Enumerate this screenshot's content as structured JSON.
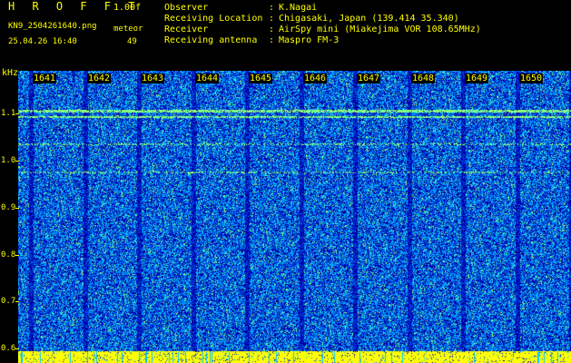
{
  "header": {
    "app_title": "H R O F F T",
    "version": "1.00f",
    "file_name": "KN9_2504261640.png",
    "timestamp": "25.04.26 16:40",
    "meteor_label": "meteor",
    "meteor_count": "49",
    "metadata": [
      {
        "key": "Observer",
        "sep": ":",
        "value": "K.Nagai"
      },
      {
        "key": "Receiving Location",
        "sep": ":",
        "value": "Chigasaki, Japan (139.414 35.340)"
      },
      {
        "key": "Receiver",
        "sep": ":",
        "value": "AirSpy mini (Miakejima VOR 108.65MHz)"
      },
      {
        "key": "Receiving antenna",
        "sep": ":",
        "value": "Maspro FM-3"
      }
    ]
  },
  "spectrogram": {
    "y_unit": "kHz",
    "y_ticks": [
      "1.1",
      "1.0",
      "0.9",
      "0.8",
      "0.7",
      "0.6"
    ],
    "y_range": [
      0.57,
      1.19
    ],
    "x_ticks": [
      "1641",
      "1642",
      "1643",
      "1644",
      "1645",
      "1646",
      "1647",
      "1648",
      "1649",
      "1650"
    ],
    "colors": {
      "background": "#0000b4",
      "noise_mid": "#0040ff",
      "noise_hi": "#00c8ff",
      "peak": "#ffff00",
      "label": "#ffff00"
    }
  }
}
